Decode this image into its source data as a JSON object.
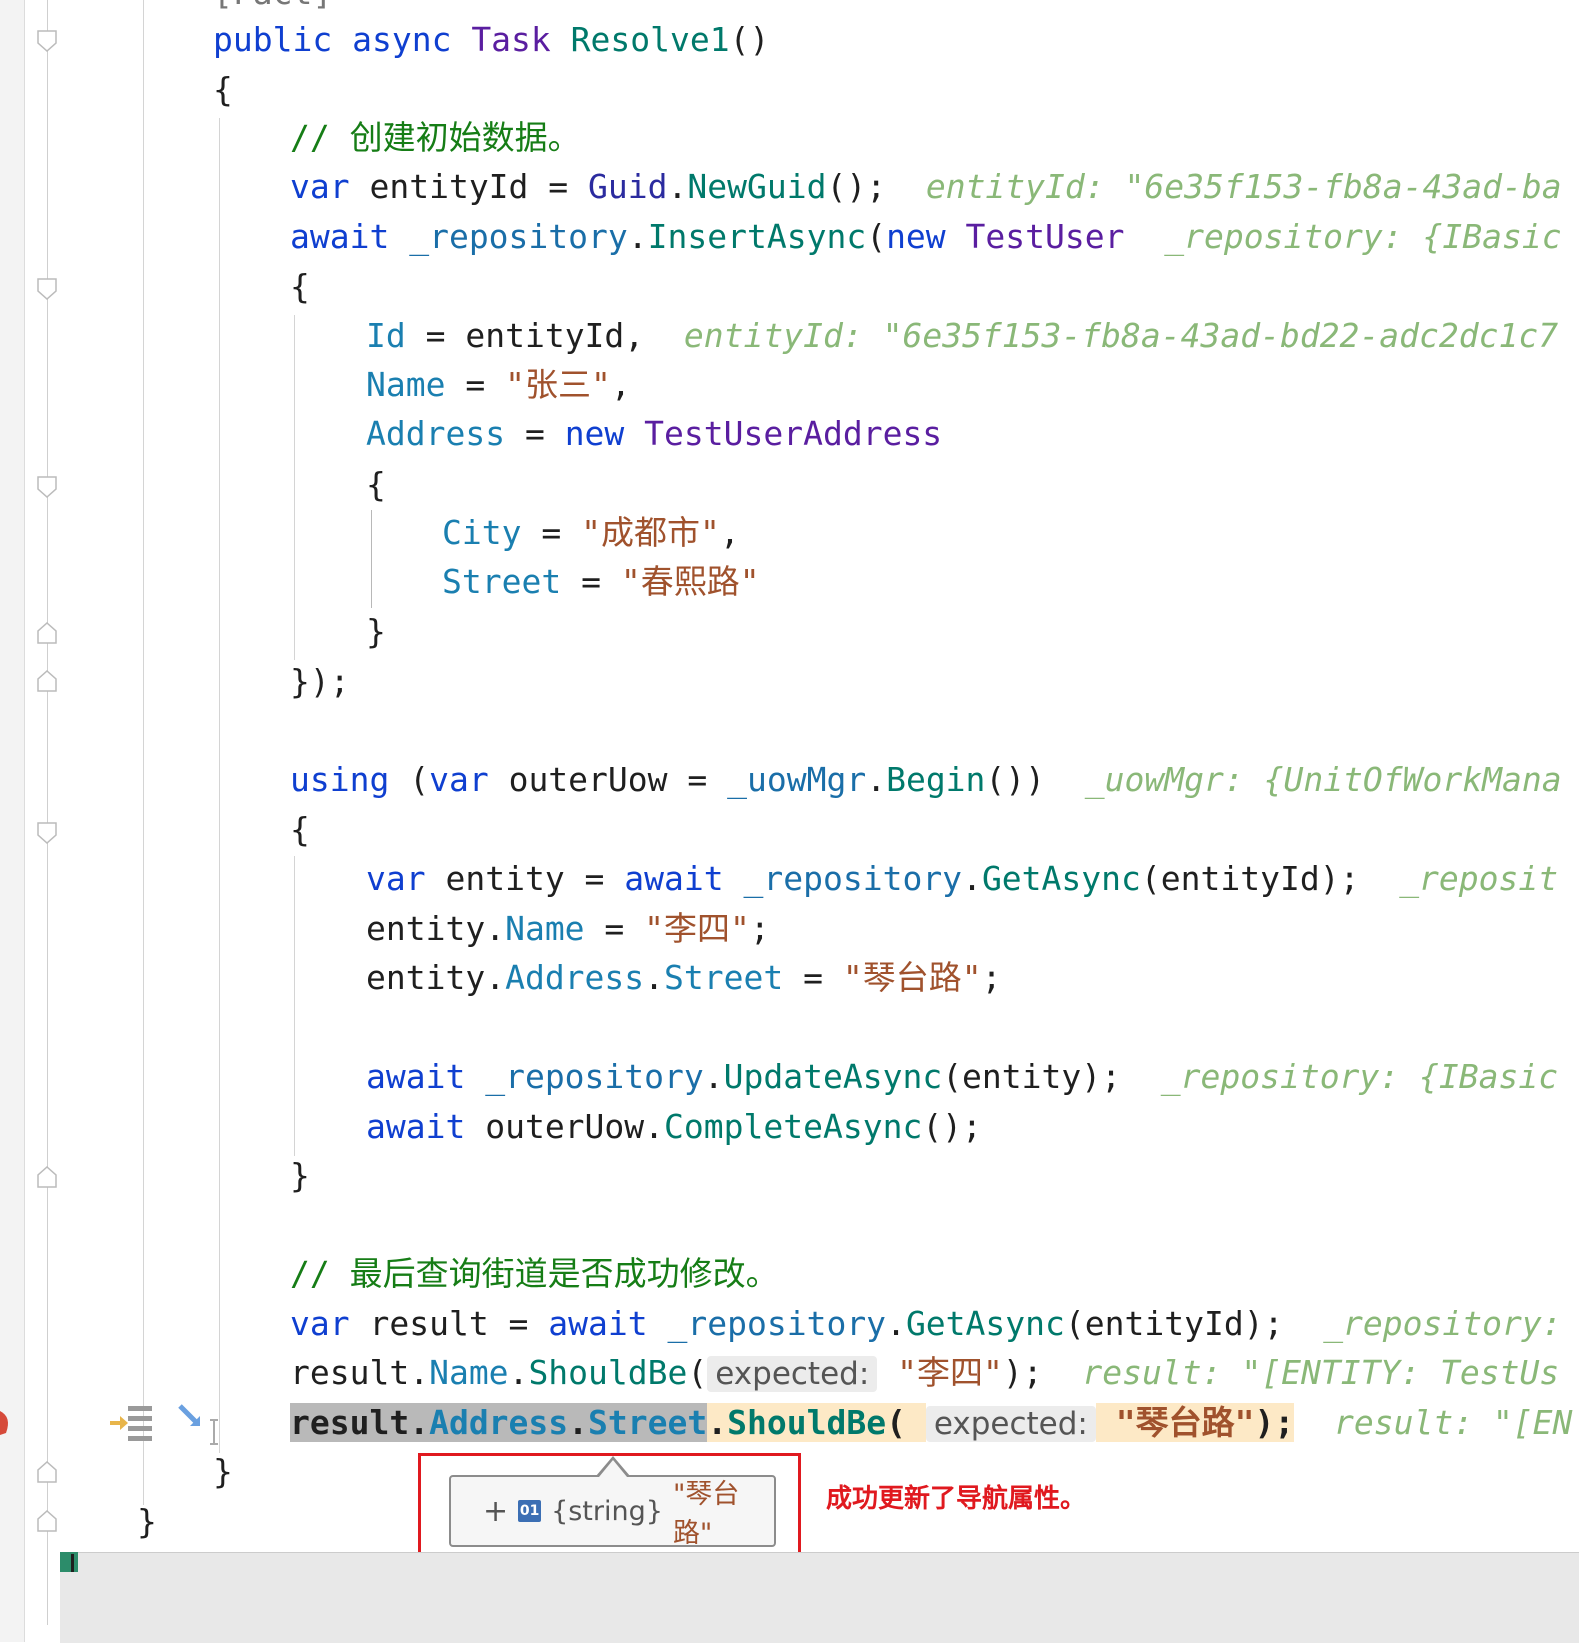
{
  "code": {
    "attribute_partial": "[Fact]",
    "method_signature": {
      "public": "public",
      "async": "async",
      "task": "Task",
      "name": "Resolve1",
      "parens": "()"
    },
    "comment_create": "// 创建初始数据。",
    "var_entityId": {
      "var": "var",
      "name": " entityId = ",
      "guid": "Guid",
      "dot": ".",
      "newguid": "NewGuid",
      "tail": "();",
      "hint": "entityId: \"6e35f153-fb8a-43ad-ba"
    },
    "insert_line": {
      "await": "await",
      "repo": " _repository",
      "dot": ".",
      "method": "InsertAsync",
      "open": "(",
      "new": "new",
      "type": " TestUser",
      "hint": "_repository: {IBasic"
    },
    "open_brace": "{",
    "id_line": {
      "prop": "Id",
      "eq": " = entityId,",
      "hint": "entityId: \"6e35f153-fb8a-43ad-bd22-adc2dc1c7"
    },
    "name_line": {
      "prop": "Name",
      "eq": " = ",
      "value": "\"张三\"",
      "comma": ","
    },
    "address_line": {
      "prop": "Address",
      "eq": " = ",
      "new": "new",
      "type": " TestUserAddress"
    },
    "city_line": {
      "prop": "City",
      "eq": " = ",
      "value": "\"成都市\"",
      "comma": ","
    },
    "street_line": {
      "prop": "Street",
      "eq": " = ",
      "value": "\"春熙路\""
    },
    "close_brace": "}",
    "close_insert": "});",
    "using_line": {
      "using": "using",
      "open": " (",
      "var": "var",
      "name": " outerUow = ",
      "mgr": "_uowMgr",
      "dot": ".",
      "begin": "Begin",
      "tail": "())",
      "hint": "_uowMgr: {UnitOfWorkMana"
    },
    "get_entity_line": {
      "var": "var",
      "name": " entity = ",
      "await": "await",
      "repo": " _repository",
      "dot": ".",
      "method": "GetAsync",
      "tail": "(entityId);",
      "hint": "_reposit"
    },
    "set_name_line": {
      "obj": "entity.",
      "prop": "Name",
      "eq": " = ",
      "value": "\"李四\"",
      "semi": ";"
    },
    "set_street_line": {
      "obj": "entity.",
      "prop1": "Address",
      "dot": ".",
      "prop2": "Street",
      "eq": " = ",
      "value": "\"琴台路\"",
      "semi": ";"
    },
    "update_line": {
      "await": "await",
      "repo": " _repository",
      "dot": ".",
      "method": "UpdateAsync",
      "tail": "(entity);",
      "hint": "_repository: {IBasic"
    },
    "complete_line": {
      "await": "await",
      "obj": " outerUow.",
      "method": "CompleteAsync",
      "tail": "();"
    },
    "comment_query": "// 最后查询街道是否成功修改。",
    "result_line": {
      "var": "var",
      "name": " result = ",
      "await": "await",
      "repo": " _repository",
      "dot": ".",
      "method": "GetAsync",
      "tail": "(entityId);",
      "hint": "_repository:"
    },
    "assert_name_line": {
      "obj": "result.",
      "prop": "Name",
      "dot": ".",
      "method": "ShouldBe",
      "open": "(",
      "param": "expected:",
      "value": "\"李四\"",
      "tail": ");",
      "hint": "result: \"[ENTITY: TestUs"
    },
    "assert_street_line": {
      "obj": "result.",
      "prop1": "Address",
      "dot1": ".",
      "prop2": "Street",
      "dot2": ".",
      "method": "ShouldBe",
      "open": "(",
      "param": "expected:",
      "value": "\"琴台路\"",
      "tail": ");",
      "hint": "result: \"[EN"
    },
    "method_close": "}",
    "class_close": "}"
  },
  "tooltip": {
    "expand": "+",
    "icon_text": "01",
    "type": "{string}",
    "value": "\"琴台路\""
  },
  "annotation": "成功更新了导航属性。",
  "colors": {
    "annotation": "#e0191f",
    "keyword": "#0000ff",
    "string": "#a0522d",
    "comment": "#167d16"
  }
}
